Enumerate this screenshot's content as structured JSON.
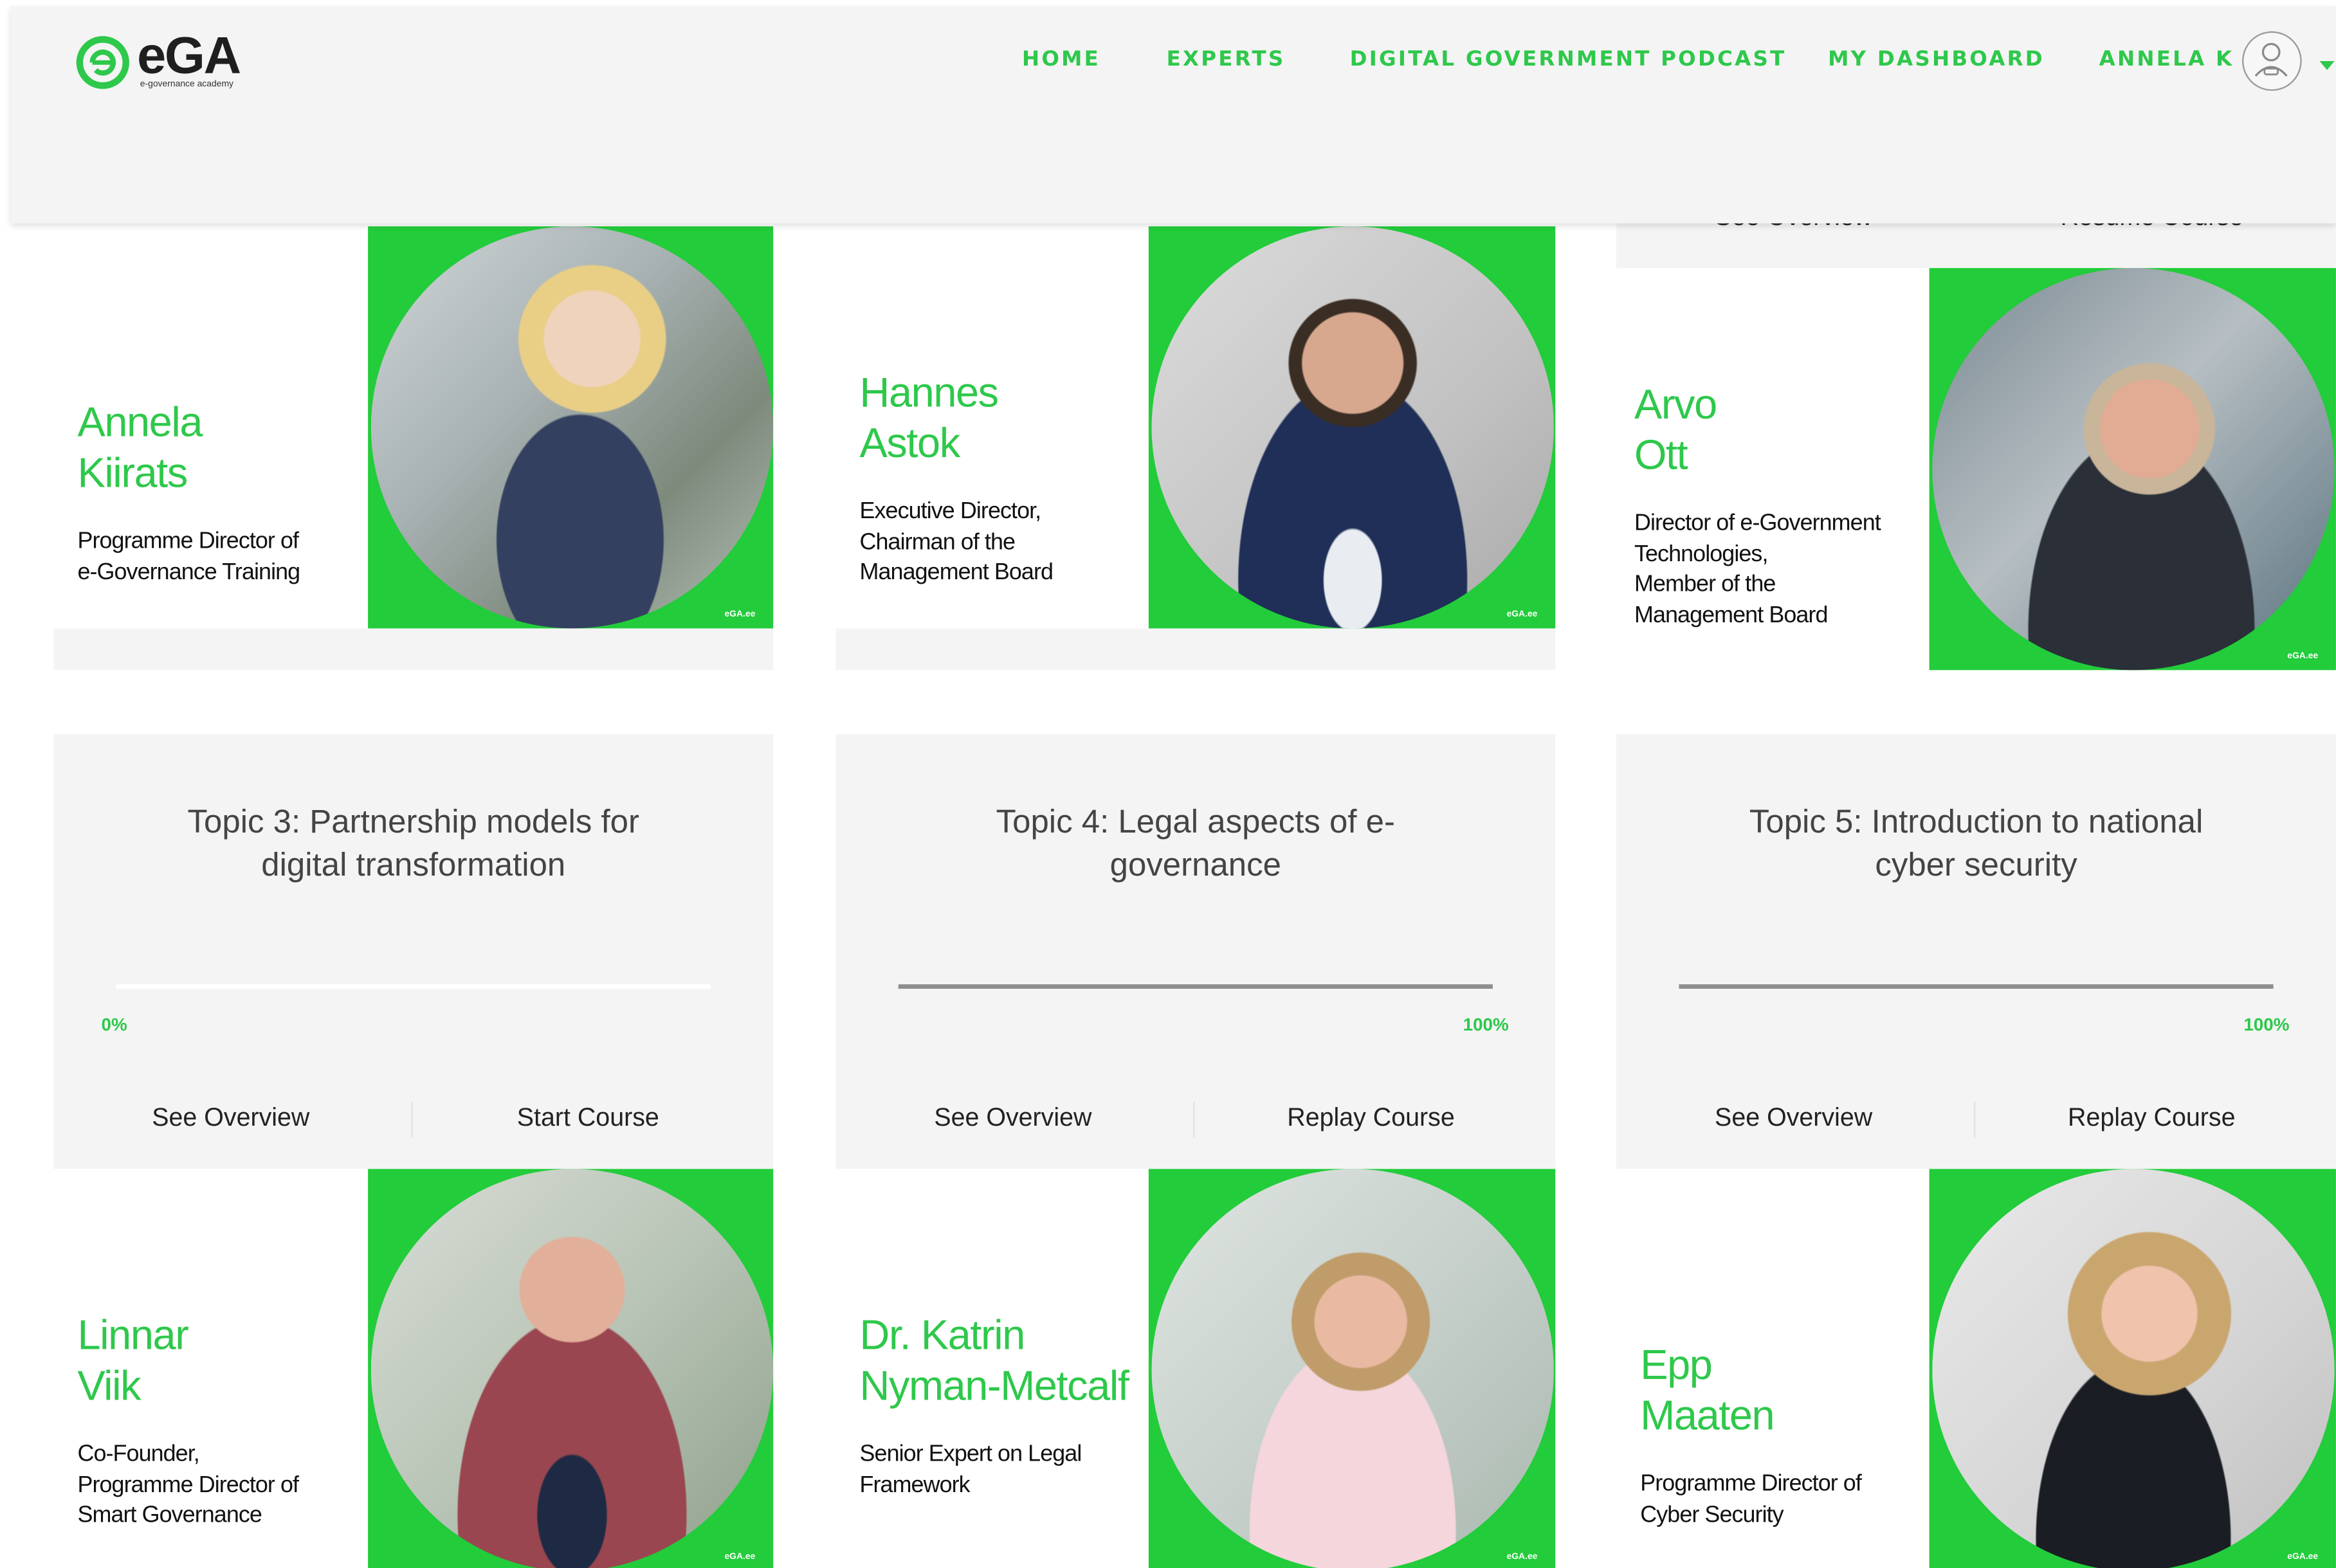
{
  "header": {
    "logo_text": "eGA",
    "logo_subtitle": "e-governance academy",
    "nav": [
      "HOME",
      "EXPERTS",
      "DIGITAL GOVERNMENT PODCAST",
      "MY DASHBOARD"
    ],
    "user_label": "ANNELA K"
  },
  "colors": {
    "accent": "#2ec84b",
    "photo_green": "#22cc3a",
    "card_bg": "#f4f4f4"
  },
  "partial_card": {
    "overview_label": "See Overview",
    "action_label": "Resume Course"
  },
  "experts_row1": [
    {
      "name": "Annela\nKiirats",
      "role": "Programme Director of\ne-Governance Training",
      "stamp": "eGA.ee"
    },
    {
      "name": "Hannes\nAstok",
      "role": "Executive Director,\nChairman of the\nManagement Board",
      "stamp": "eGA.ee"
    },
    {
      "name": "Arvo\nOtt",
      "role": "Director of e-Government\nTechnologies,\nMember of the\nManagement Board",
      "stamp": "eGA.ee"
    }
  ],
  "topics": [
    {
      "title": "Topic 3: Partnership models for\ndigital transformation",
      "progress_label": "0%",
      "progress": 0,
      "overview_label": "See Overview",
      "action_label": "Start Course"
    },
    {
      "title": "Topic 4: Legal aspects of e-\ngovernance",
      "progress_label": "100%",
      "progress": 1,
      "overview_label": "See Overview",
      "action_label": "Replay Course"
    },
    {
      "title": "Topic 5: Introduction to national\ncyber security",
      "progress_label": "100%",
      "progress": 1,
      "overview_label": "See Overview",
      "action_label": "Replay Course"
    }
  ],
  "experts_row2": [
    {
      "name": "Linnar\nViik",
      "role": "Co-Founder,\nProgramme Director of\nSmart Governance",
      "stamp": "eGA.ee"
    },
    {
      "name": "Dr. Katrin\nNyman-Metcalf",
      "role": "Senior Expert on Legal\nFramework",
      "stamp": "eGA.ee"
    },
    {
      "name": "Epp\nMaaten",
      "role": "Programme Director of\nCyber Security",
      "stamp": "eGA.ee"
    }
  ]
}
